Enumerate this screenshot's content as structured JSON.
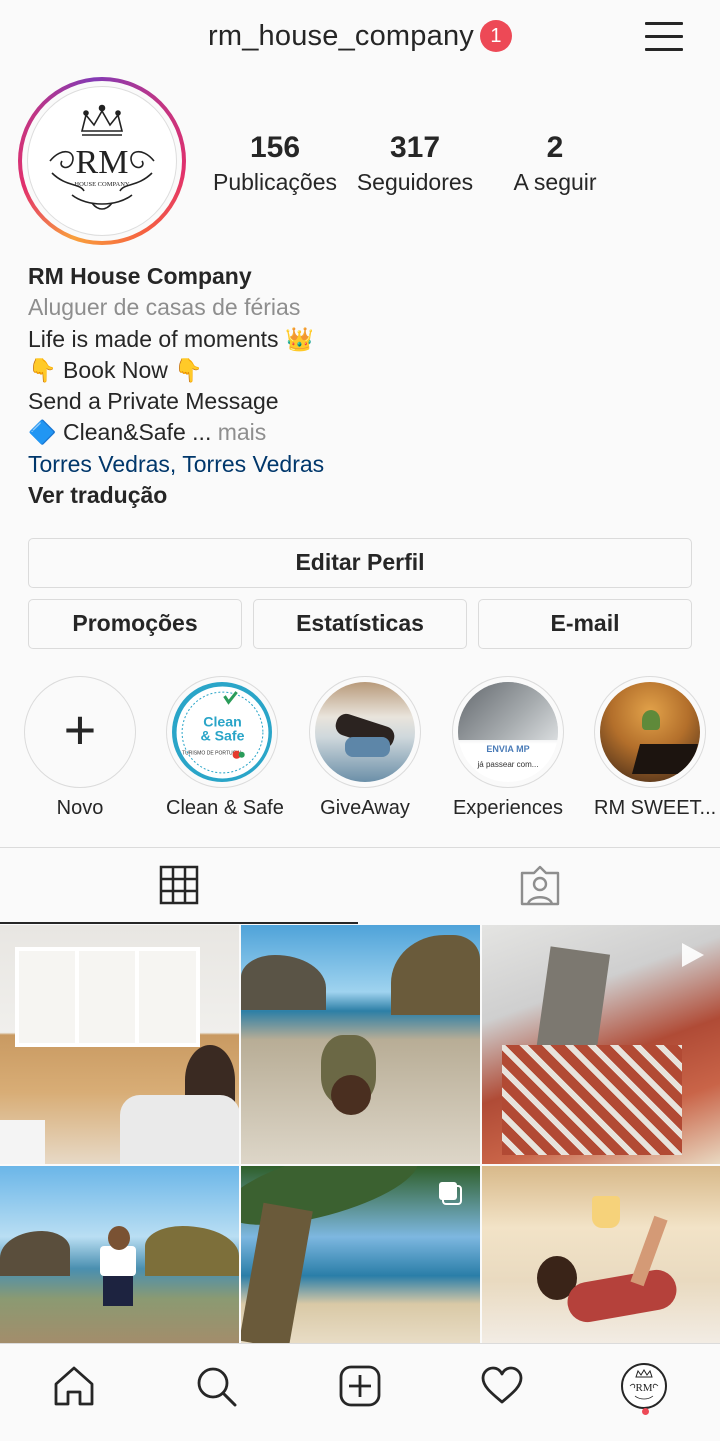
{
  "header": {
    "username": "rm_house_company",
    "notification_count": "1"
  },
  "profile": {
    "logo_text": "RM",
    "logo_subtext": "HOUSE COMPANY",
    "stats": [
      {
        "value": "156",
        "label": "Publicações"
      },
      {
        "value": "317",
        "label": "Seguidores"
      },
      {
        "value": "2",
        "label": "A seguir"
      }
    ]
  },
  "bio": {
    "name": "RM House Company",
    "category": "Aluguer de casas de férias",
    "line1": "Life is made of moments 👑",
    "line2": "👇 Book Now 👇",
    "line3": "Send a Private Message",
    "line4": "🔷 Clean&Safe ...",
    "more": "mais",
    "location": "Torres Vedras, Torres Vedras",
    "translate": "Ver tradução"
  },
  "buttons": {
    "edit_profile": "Editar Perfil",
    "promotions": "Promoções",
    "stats": "Estatísticas",
    "email": "E-mail"
  },
  "highlights": [
    {
      "label": "Novo"
    },
    {
      "label": "Clean & Safe",
      "badge_text": "Clean & Safe",
      "badge_small": "TURISMO DE PORTUGAL"
    },
    {
      "label": "GiveAway"
    },
    {
      "label": "Experiences",
      "overlay_text": "ENVIA MP",
      "overlay_sub": "já passear com..."
    },
    {
      "label": "RM SWEET..."
    }
  ],
  "colors": {
    "accent_blue": "#00376b",
    "notification_red": "#ed4956",
    "border": "#dbdbdb"
  },
  "icons": {
    "menu": "hamburger-icon",
    "grid": "grid-icon",
    "tagged": "tagged-icon",
    "home": "home-icon",
    "search": "search-icon",
    "add": "add-post-icon",
    "activity": "heart-icon",
    "profile": "profile-avatar-icon"
  }
}
